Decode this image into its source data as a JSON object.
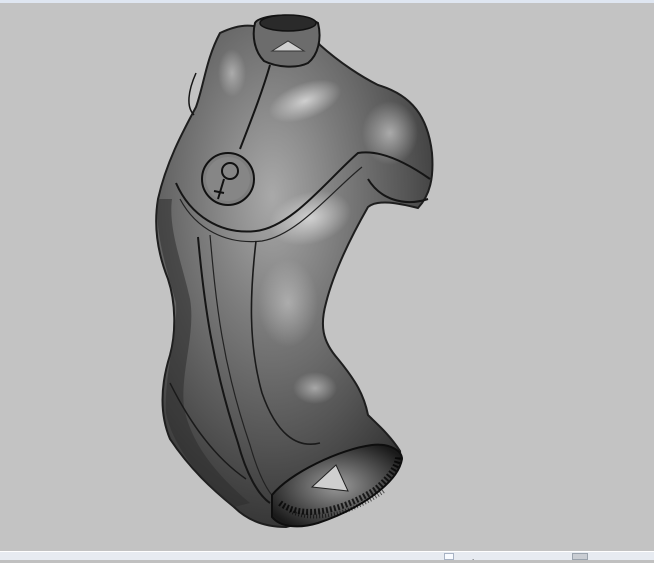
{
  "viewport": {
    "background": "#c3c3c3",
    "model": "shaded-torso-3d-model"
  },
  "status_bar": {
    "text": "."
  }
}
